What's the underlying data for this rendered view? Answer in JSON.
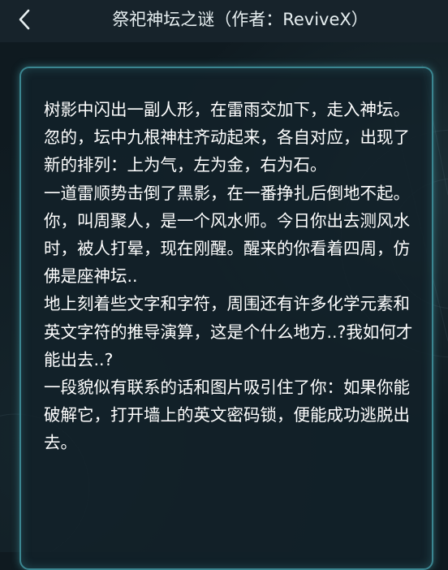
{
  "header": {
    "title": "祭祀神坛之谜（作者：ReviveX）",
    "back_icon": "chevron-left-icon"
  },
  "story": {
    "paragraphs": [
      "树影中闪出一副人形，在雷雨交加下，走入神坛。",
      "忽的，坛中九根神柱齐动起来，各自对应，出现了新的排列：上为气，左为金，右为石。",
      "一道雷顺势击倒了黑影，在一番挣扎后倒地不起。",
      "你，叫周聚人，是一个风水师。今日你出去测风水时，被人打晕，现在刚醒。醒来的你看着四周，仿佛是座神坛..",
      "地上刻着些文字和字符，周围还有许多化学元素和英文字符的推导演算，这是个什么地方..?我如何才能出去..?",
      "一段貌似有联系的话和图片吸引住了你：如果你能破解它，打开墙上的英文密码锁，便能成功逃脱出去。"
    ]
  },
  "colors": {
    "background": "#0f1a20",
    "topbar": "#17232b",
    "card_border": "#3b8691",
    "text": "#ffffff"
  }
}
